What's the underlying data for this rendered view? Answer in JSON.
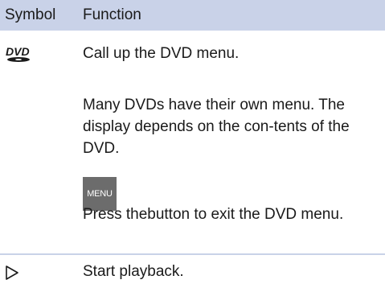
{
  "header": {
    "symbol_label": "Symbol",
    "function_label": "Function"
  },
  "rows": [
    {
      "icon": "dvd-logo-icon",
      "paragraphs": [
        "Call up the DVD menu.",
        "Many DVDs have their own menu. The display depends on the con-tents of the DVD."
      ],
      "button_label": "MENU",
      "after_button": "Press thebutton to exit the DVD menu."
    },
    {
      "icon": "play-triangle-icon",
      "paragraphs": [
        "Start playback."
      ]
    }
  ],
  "colors": {
    "header_bg": "#c9d2e8",
    "menu_button_bg": "#6c6c6c"
  }
}
